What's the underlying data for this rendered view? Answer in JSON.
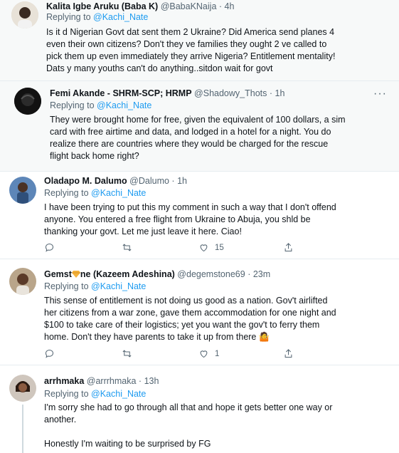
{
  "reply_prefix": "Replying to",
  "tweets": [
    {
      "name": "Kalita Igbe Aruku (Baba K)",
      "handle": "@BabaKNaija",
      "time": "4h",
      "mention": "@Kachi_Nate",
      "lines": [
        "Is it d Nigerian Govt dat sent them 2 Ukraine? Did America send planes 4",
        "even their own citizens? Don't they ve families they ought 2 ve called to",
        "pick them up even immediately they arrive Nigeria? Entitlement mentality!",
        "Dats y many youths can't do anything..sitdon wait for govt"
      ]
    },
    {
      "name": "Femi Akande - SHRM-SCP; HRMP",
      "handle": "@Shadowy_Thots",
      "time": "1h",
      "mention": "@Kachi_Nate",
      "lines": [
        "They were brought home for free, given the equivalent of 100 dollars, a sim",
        "card with free airtime and data, and lodged in a hotel for a night. You do",
        "realize there are countries where they would be charged for the rescue",
        "flight back home right?"
      ]
    },
    {
      "name": "Oladapo M. Dalumo",
      "handle": "@Dalumo",
      "time": "1h",
      "mention": "@Kachi_Nate",
      "lines": [
        "I have been trying to put this my comment in such a way that I don't offend",
        "anyone. You entered a free flight from Ukraine to Abuja, you shld be",
        "thanking your govt. Let me just leave it here. Ciao!"
      ],
      "likes": "15"
    },
    {
      "name_a": "Gemst",
      "name_b": "ne (Kazeem Adeshina)",
      "handle": "@degemstone69",
      "time": "23m",
      "mention": "@Kachi_Nate",
      "lines": [
        "This sense of entitlement is not doing us good as a nation. Gov't airlifted",
        "her citizens from a war zone, gave them accommodation for one night and",
        "$100 to take care of their logistics; yet you want the gov't to ferry them",
        "home. Don't they have parents to take it up from there"
      ],
      "emoji": "🤷",
      "likes": "1"
    },
    {
      "name": "arrhmaka",
      "handle": "@arrrhmaka",
      "time": "13h",
      "mention": "@Kachi_Nate",
      "lines": [
        "I'm sorry she had to go through all that and hope it gets better one way or",
        "another.",
        "",
        "Honestly I'm waiting to be surprised by FG"
      ]
    }
  ],
  "separator": "·",
  "more_glyph": "···",
  "colors": {
    "mention": "#1d9bf0",
    "secondary": "#536471",
    "highlight_bg": "#f7f9f9"
  },
  "icons": [
    "reply-icon",
    "retweet-icon",
    "like-icon",
    "share-icon",
    "more-icon",
    "gem-emoji-icon"
  ]
}
